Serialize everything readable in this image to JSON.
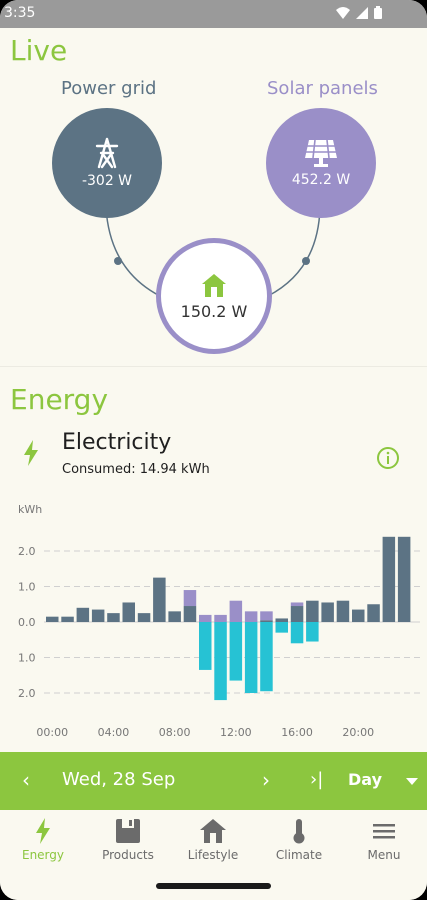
{
  "status_bar": {
    "time": "3:35",
    "icons": [
      "wifi-icon",
      "signal-icon",
      "battery-icon"
    ]
  },
  "live": {
    "title": "Live",
    "grid": {
      "label": "Power grid",
      "value": "-302 W",
      "icon": "transmission-tower-icon",
      "color": "#5c7384"
    },
    "solar": {
      "label": "Solar panels",
      "value": "452.2 W",
      "icon": "solar-panel-icon",
      "color": "#9a8fc8"
    },
    "home": {
      "value": "150.2 W",
      "icon": "home-icon",
      "color": "#9a8fc8"
    }
  },
  "energy": {
    "title": "Energy",
    "electricity": {
      "title": "Electricity",
      "consumed": "Consumed: 14.94 kWh",
      "icon": "lightning-icon",
      "info_icon": "info-icon"
    }
  },
  "chart_data": {
    "type": "bar",
    "ylabel": "kWh",
    "ytick_labels": [
      "2.0",
      "1.0",
      "0.0",
      "1.0",
      "2.0"
    ],
    "ylim": [
      -2.0,
      2.0
    ],
    "xtick_labels": [
      "00:00",
      "04:00",
      "08:00",
      "12:00",
      "16:00",
      "20:00"
    ],
    "grid": true,
    "colors": {
      "grid": "#5c7384",
      "solar": "#9a8fc8",
      "export": "#26c2d4"
    },
    "series": [
      {
        "values": [
          0.15,
          0.15,
          0.4,
          0.35,
          0.25,
          0.55,
          0.25,
          1.25,
          0.3,
          0.45,
          0.0,
          0.0,
          0.0,
          0.0,
          0.05,
          0.1,
          0.45,
          0.6,
          0.55,
          0.6,
          0.35,
          0.5,
          2.4,
          2.4
        ]
      },
      {
        "values": [
          0.0,
          0.0,
          0.0,
          0.0,
          0.0,
          0.0,
          0.0,
          0.0,
          0.0,
          0.45,
          0.2,
          0.2,
          0.6,
          0.3,
          0.25,
          0.0,
          0.1,
          0.0,
          0.0,
          0.0,
          0.0,
          0.0,
          0.0,
          0.0
        ]
      },
      {
        "values": [
          0.0,
          0.0,
          0.0,
          0.0,
          0.0,
          0.0,
          0.0,
          0.0,
          0.0,
          0.0,
          -1.35,
          -2.2,
          -1.65,
          -2.0,
          -1.95,
          -0.3,
          -0.6,
          -0.55,
          0.0,
          0.0,
          0.0,
          0.0,
          0.0,
          0.0
        ]
      }
    ]
  },
  "date_bar": {
    "prev": "‹",
    "date": "Wed, 28 Sep",
    "next": "›",
    "last": "›|",
    "period": "Day"
  },
  "nav": [
    {
      "label": "Energy",
      "icon": "lightning-icon",
      "active": true
    },
    {
      "label": "Products",
      "icon": "products-icon",
      "active": false
    },
    {
      "label": "Lifestyle",
      "icon": "house-icon",
      "active": false
    },
    {
      "label": "Climate",
      "icon": "thermometer-icon",
      "active": false
    },
    {
      "label": "Menu",
      "icon": "menu-icon",
      "active": false
    }
  ]
}
